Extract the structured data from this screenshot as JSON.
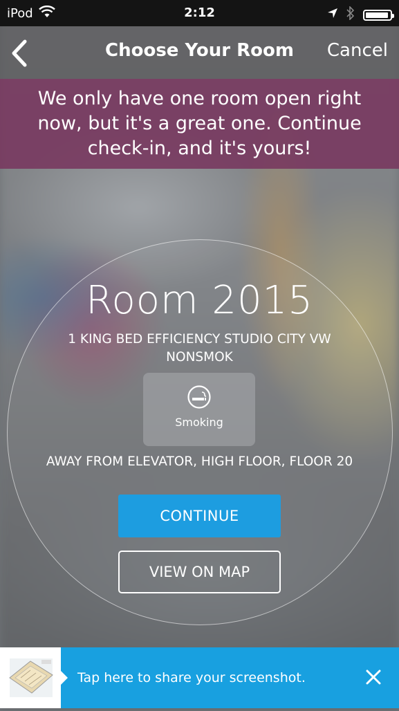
{
  "status_bar": {
    "carrier": "iPod",
    "time": "2:12",
    "battery_level": 0.95,
    "icons": [
      "wifi-icon",
      "location-arrow-icon",
      "bluetooth-icon",
      "battery-icon"
    ]
  },
  "nav": {
    "title": "Choose Your Room",
    "cancel_label": "Cancel",
    "back_icon": "chevron-left-icon"
  },
  "banner": {
    "message": "We only have one room open right now, but it's a great one. Continue check-in, and it's yours!"
  },
  "room": {
    "number": "Room 2015",
    "type": "1 KING BED EFFICIENCY STUDIO CITY VW NONSMOK",
    "feature_icon": "smoking-icon",
    "feature_label": "Smoking",
    "location": "AWAY FROM ELEVATOR, HIGH FLOOR, FLOOR 20"
  },
  "actions": {
    "continue_label": "CONTINUE",
    "map_label": "VIEW ON MAP"
  },
  "share": {
    "text": "Tap here to share your screenshot.",
    "close_icon": "close-icon"
  },
  "colors": {
    "accent": "#1d9de0",
    "banner": "#78375f",
    "share_bar": "#18a0e0"
  }
}
